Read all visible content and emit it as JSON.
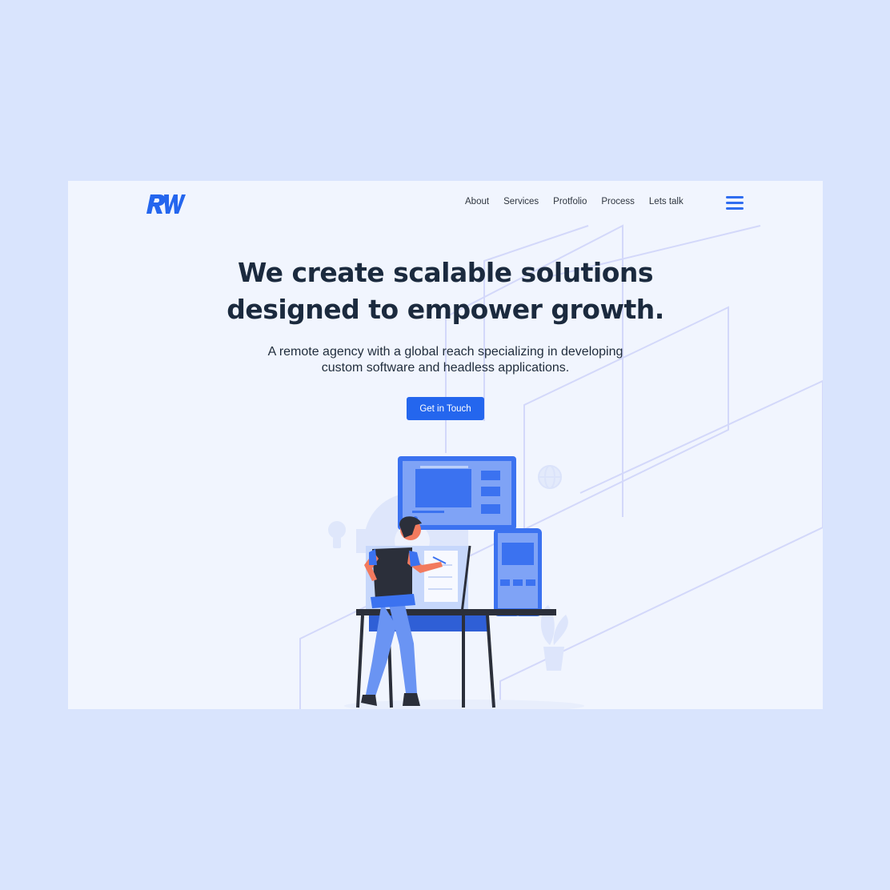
{
  "brand": {
    "logo_text": "RW",
    "accent": "#2466ee",
    "text_dark": "#1b2a3e"
  },
  "nav": {
    "links": [
      "About",
      "Services",
      "Protfolio",
      "Process",
      "Lets talk"
    ],
    "menu_icon": "hamburger-menu-icon"
  },
  "hero": {
    "title_line1": "We create scalable solutions",
    "title_line2": "designed to empower growth.",
    "subtitle_line1": "A remote agency with a global reach specializing in developing",
    "subtitle_line2": "custom software and headless applications.",
    "cta_label": "Get in Touch"
  },
  "illustration": {
    "subject": "designer-at-drafting-desk-illustration",
    "icons": [
      "lightbulb-icon",
      "globe-icon",
      "gear-icon",
      "plant-icon",
      "monitor-icon",
      "tablet-icon"
    ]
  }
}
